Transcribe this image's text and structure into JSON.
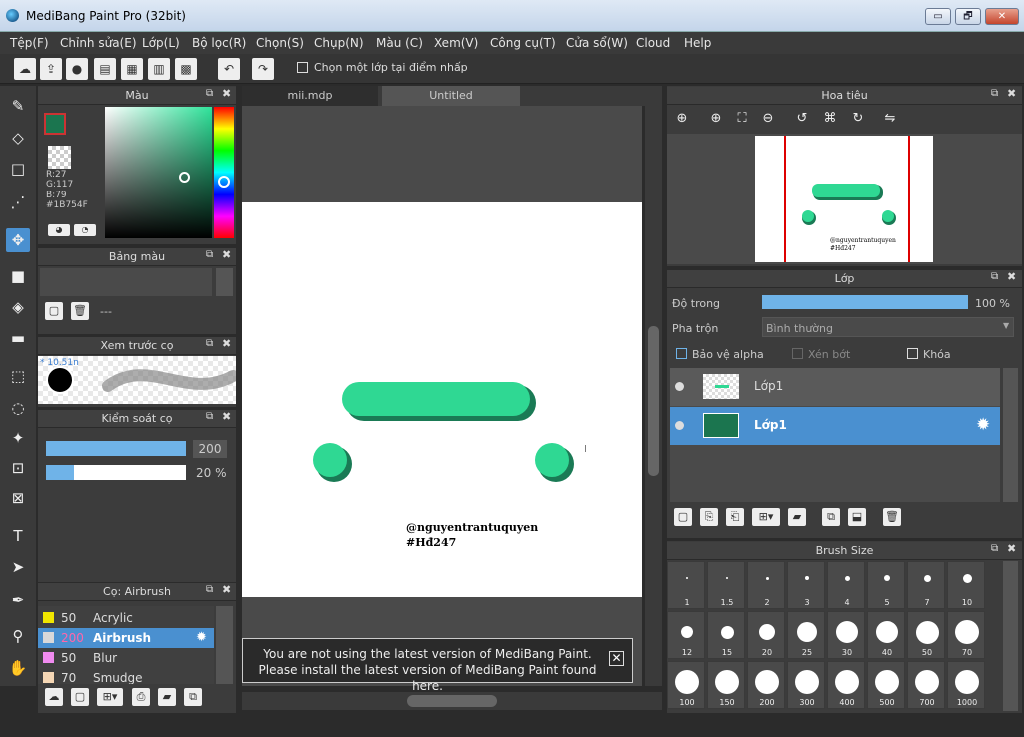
{
  "window": {
    "title": "MediBang Paint Pro (32bit)",
    "min": "▭",
    "max": "🗗",
    "close": "✕"
  },
  "menu": [
    "Tệp(F)",
    "Chỉnh sửa(E)",
    "Lớp(L)",
    "Bộ lọc(R)",
    "Chọn(S)",
    "Chụp(N)",
    "Màu (C)",
    "Xem(V)",
    "Công cụ(T)",
    "Cửa sổ(W)",
    "Cloud",
    "Help"
  ],
  "toolbar": {
    "merge_label": "Chọn một lớp tại điểm nhấp"
  },
  "color_panel": {
    "title": "Màu",
    "r": "R:27",
    "g": "G:117",
    "b": "B:79",
    "hex": "#1B754F",
    "fg_color": "#1b754f"
  },
  "palette_panel": {
    "title": "Bảng màu",
    "selected": "---"
  },
  "brush_preview": {
    "title": "Xem trước cọ",
    "size_text": "* 10.51n"
  },
  "brush_control": {
    "title": "Kiểm soát cọ",
    "size": "200",
    "opacity": "20 %"
  },
  "brush_list": {
    "title": "Cọ: Airbrush",
    "items": [
      {
        "size": "50",
        "name": "Acrylic",
        "swatch": "#f2e600"
      },
      {
        "size": "200",
        "name": "Airbrush",
        "swatch": "#d9d9d9"
      },
      {
        "size": "50",
        "name": "Blur",
        "swatch": "#f08bef"
      },
      {
        "size": "70",
        "name": "Smudge",
        "swatch": "#f5d7b5"
      }
    ]
  },
  "documents": {
    "tabs": [
      "mii.mdp",
      "Untitled"
    ]
  },
  "canvas": {
    "watermark1": "@nguyentrantuquyen",
    "watermark2": "#Hđ247",
    "cursor": "I"
  },
  "notification": {
    "line1": "You are not using the latest version of MediBang Paint.",
    "line2": "Please install the latest version of MediBang Paint found here.",
    "close": "✕"
  },
  "navigator": {
    "title": "Hoa tiêu",
    "mini_text1": "@nguyentrantuquyen",
    "mini_text2": "#Hđ247"
  },
  "layers": {
    "title": "Lớp",
    "opacity_label": "Độ trong",
    "opacity": "100 %",
    "blend_label": "Pha trộn",
    "blend": "Bình thường",
    "protect_alpha": "Bảo vệ alpha",
    "clipping": "Xén bớt",
    "lock": "Khóa",
    "items": [
      {
        "name": "Lớp1",
        "selected": false
      },
      {
        "name": "Lớp1",
        "selected": true
      }
    ]
  },
  "brush_size": {
    "title": "Brush Size",
    "sizes": [
      "1",
      "1.5",
      "2",
      "3",
      "4",
      "5",
      "7",
      "10",
      "12",
      "15",
      "20",
      "25",
      "30",
      "40",
      "50",
      "70",
      "100",
      "150",
      "200",
      "300",
      "400",
      "500",
      "700",
      "1000"
    ]
  }
}
